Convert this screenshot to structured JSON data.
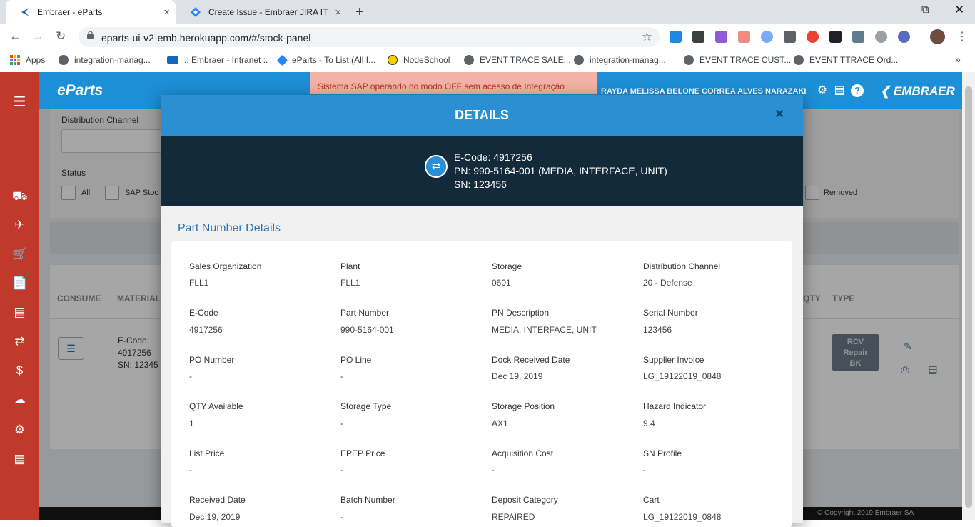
{
  "browser": {
    "tabs": [
      {
        "title": "Embraer - eParts",
        "close": "×"
      },
      {
        "title": "Create Issue - Embraer JIRA IT",
        "close": "×"
      }
    ],
    "new_tab": "+",
    "url": "eparts-ui-v2-emb.herokuapp.com/#/stock-panel",
    "bookmarks": [
      "Apps",
      "integration-manag...",
      ".: Embraer - Intranet :.",
      "eParts - To List (All I...",
      "NodeSchool",
      "EVENT TRACE SALE...",
      "integration-manag...",
      "EVENT TRACE CUST...",
      "EVENT TTRACE Ord..."
    ],
    "bookmarks_more": "»"
  },
  "app": {
    "brand": "eParts",
    "sap_warning": "Sistema SAP operando no modo OFF sem acesso de Integração",
    "user_name": "RAYDA MELISSA BELONE CORREA ALVES NARAZAKI",
    "company_logo": "EMBRAER",
    "filters": {
      "distribution_channel_label": "Distribution Channel",
      "status_label": "Status",
      "status_all": "All",
      "status_sap_stock": "SAP Stoc",
      "status_removed": "Removed"
    },
    "table": {
      "headers": [
        "CONSUME",
        "MATERIAL",
        "QTY",
        "TYPE"
      ],
      "row": {
        "ecode_label": "E-Code:",
        "ecode_value": "4917256",
        "sn_label": "SN: 12345",
        "rcv_button": [
          "RCV",
          "Repair",
          "BK"
        ]
      }
    },
    "footer_text": "© Copyright 2019 Embraer SA"
  },
  "modal": {
    "title": "DETAILS",
    "close": "×",
    "ecode": "E-Code: 4917256",
    "pn": "PN: 990-5164-001 (MEDIA, INTERFACE, UNIT)",
    "sn": "SN: 123456",
    "section_title": "Part Number Details",
    "fields": [
      {
        "label": "Sales Organization",
        "value": "FLL1"
      },
      {
        "label": "Plant",
        "value": "FLL1"
      },
      {
        "label": "Storage",
        "value": "0601"
      },
      {
        "label": "Distribution Channel",
        "value": "20 - Defense"
      },
      {
        "label": "E-Code",
        "value": "4917256"
      },
      {
        "label": "Part Number",
        "value": "990-5164-001"
      },
      {
        "label": "PN Description",
        "value": "MEDIA, INTERFACE, UNIT"
      },
      {
        "label": "Serial Number",
        "value": "123456"
      },
      {
        "label": "PO Number",
        "value": "-"
      },
      {
        "label": "PO Line",
        "value": "-"
      },
      {
        "label": "Dock Received Date",
        "value": "Dec 19, 2019"
      },
      {
        "label": "Supplier Invoice",
        "value": "LG_19122019_0848"
      },
      {
        "label": "QTY Available",
        "value": "1"
      },
      {
        "label": "Storage Type",
        "value": "-"
      },
      {
        "label": "Storage Position",
        "value": "AX1"
      },
      {
        "label": "Hazard Indicator",
        "value": "9.4"
      },
      {
        "label": "List Price",
        "value": "-"
      },
      {
        "label": "EPEP Price",
        "value": "-"
      },
      {
        "label": "Acquisition Cost",
        "value": "-"
      },
      {
        "label": "SN Profile",
        "value": "-"
      },
      {
        "label": "Received Date",
        "value": "Dec 19, 2019"
      },
      {
        "label": "Batch Number",
        "value": "-"
      },
      {
        "label": "Deposit Category",
        "value": "REPAIRED"
      },
      {
        "label": "Cart",
        "value": "LG_19122019_0848"
      }
    ]
  },
  "colors": {
    "sidebar": "#c1392b",
    "topbar": "#1d8fd6",
    "modal_header": "#2a8fd3",
    "modal_band": "#132a3a",
    "link_blue": "#2a72b5"
  }
}
